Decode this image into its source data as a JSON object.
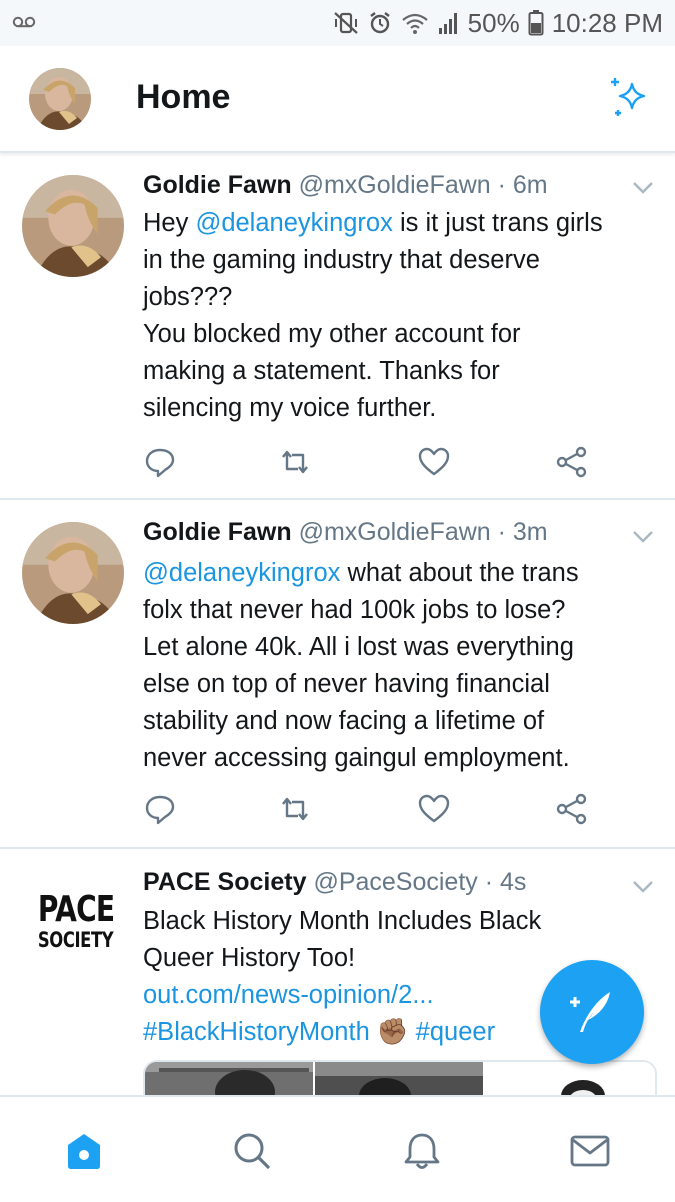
{
  "status_bar": {
    "battery_percent": "50%",
    "time": "10:28 PM"
  },
  "header": {
    "title": "Home"
  },
  "tweets": [
    {
      "name": "Goldie Fawn",
      "handle": "@mxGoldieFawn",
      "separator": " · ",
      "time": "6m",
      "lines": [
        [
          {
            "t": "Hey ",
            "link": false
          },
          {
            "t": "@delaneykingrox",
            "link": true
          },
          {
            "t": " is it just trans girls",
            "link": false
          }
        ],
        [
          {
            "t": "in the gaming industry that deserve",
            "link": false
          }
        ],
        [
          {
            "t": "jobs???",
            "link": false
          }
        ],
        [
          {
            "t": "You blocked my other account for",
            "link": false
          }
        ],
        [
          {
            "t": "making a statement. Thanks for",
            "link": false
          }
        ],
        [
          {
            "t": "silencing my voice further.",
            "link": false
          }
        ]
      ]
    },
    {
      "name": "Goldie Fawn",
      "handle": "@mxGoldieFawn",
      "separator": " · ",
      "time": "3m",
      "lines": [
        [
          {
            "t": "@delaneykingrox",
            "link": true
          },
          {
            "t": " what about the trans",
            "link": false
          }
        ],
        [
          {
            "t": "folx that never had 100k jobs to lose?",
            "link": false
          }
        ],
        [
          {
            "t": "Let alone 40k. All i lost was everything",
            "link": false
          }
        ],
        [
          {
            "t": "else on top of never having financial",
            "link": false
          }
        ],
        [
          {
            "t": "stability and now facing a lifetime of",
            "link": false
          }
        ],
        [
          {
            "t": "never accessing gaingul employment.",
            "link": false
          }
        ]
      ]
    },
    {
      "name": "PACE Society",
      "handle": "@PaceSociety",
      "separator": " · ",
      "time": "4s",
      "logo_line1": "PACE",
      "logo_line2": "SOCIETY",
      "lines": [
        [
          {
            "t": "Black History Month Includes Black",
            "link": false
          }
        ],
        [
          {
            "t": "Queer History Too!",
            "link": false
          }
        ],
        [
          {
            "t": "out.com/news-opinion/2...",
            "link": true
          }
        ],
        [
          {
            "t": "#BlackHistoryMonth",
            "link": true
          },
          {
            "t": " ✊🏽 ",
            "link": false
          },
          {
            "t": "#queer",
            "link": true
          }
        ]
      ]
    }
  ],
  "icons": {
    "accent": "#1da1f2",
    "reply": "reply-icon",
    "retweet": "retweet-icon",
    "like": "heart-icon",
    "share": "share-icon",
    "compose": "compose-tweet-icon",
    "home": "home-icon",
    "search": "search-icon",
    "notifications": "bell-icon",
    "messages": "mail-icon"
  }
}
